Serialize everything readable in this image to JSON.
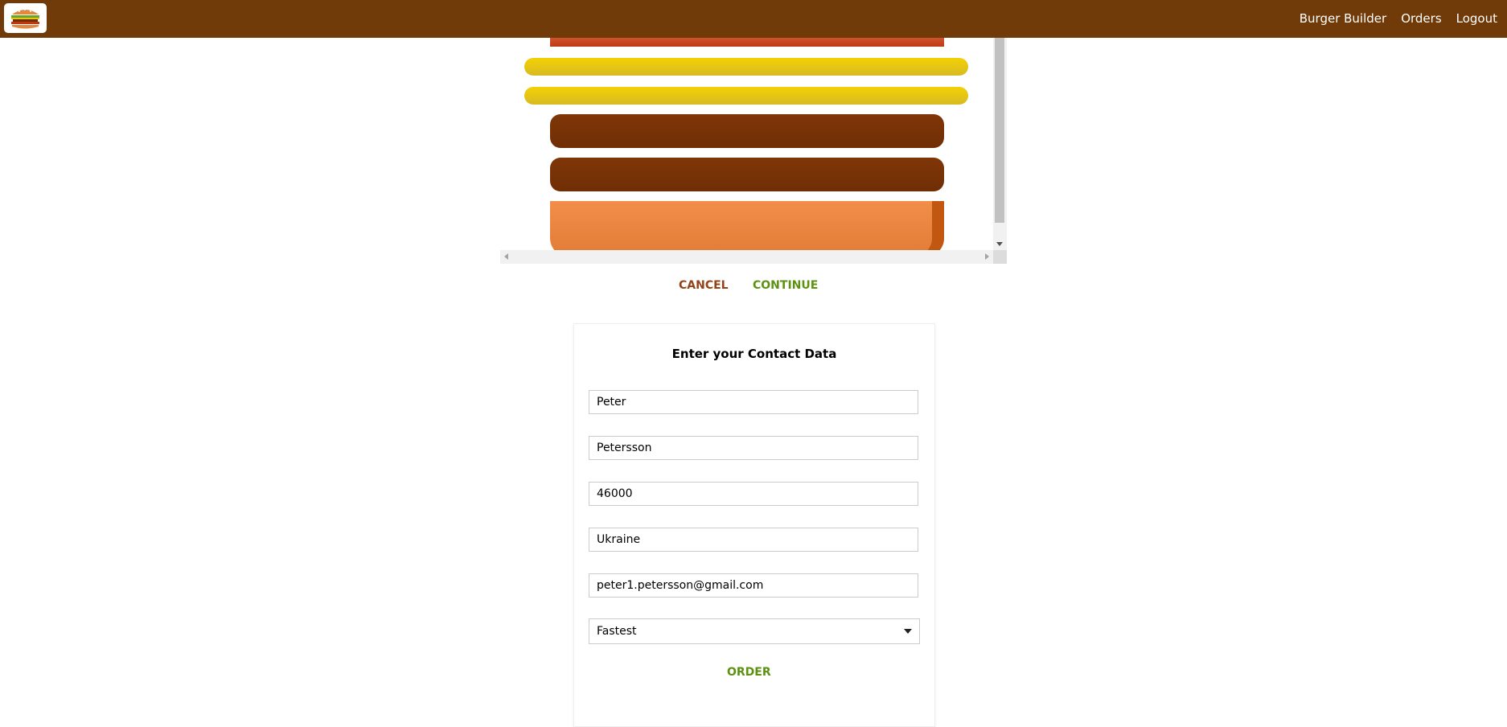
{
  "toolbar": {
    "logo_icon": "burger-logo-icon",
    "nav": {
      "burger_builder": "Burger Builder",
      "orders": "Orders",
      "logout": "Logout"
    }
  },
  "burger": {
    "ingredients": [
      "bacon",
      "cheese",
      "cheese",
      "meat",
      "meat",
      "bread-bottom"
    ],
    "colors": {
      "bacon": "#bf3813",
      "cheese": "#e6c812",
      "meat": "#7f3608",
      "bread": "#e27b36"
    }
  },
  "summary_buttons": {
    "cancel": "CANCEL",
    "continue": "CONTINUE"
  },
  "contact": {
    "title": "Enter your Contact Data",
    "fields": {
      "name": "Peter",
      "surname": "Petersson",
      "zip": "46000",
      "country": "Ukraine",
      "email": "peter1.petersson@gmail.com"
    },
    "delivery_method": "Fastest",
    "order_label": "ORDER"
  },
  "colors": {
    "toolbar_bg": "#703b09",
    "danger": "#944317",
    "success": "#5c9210"
  }
}
